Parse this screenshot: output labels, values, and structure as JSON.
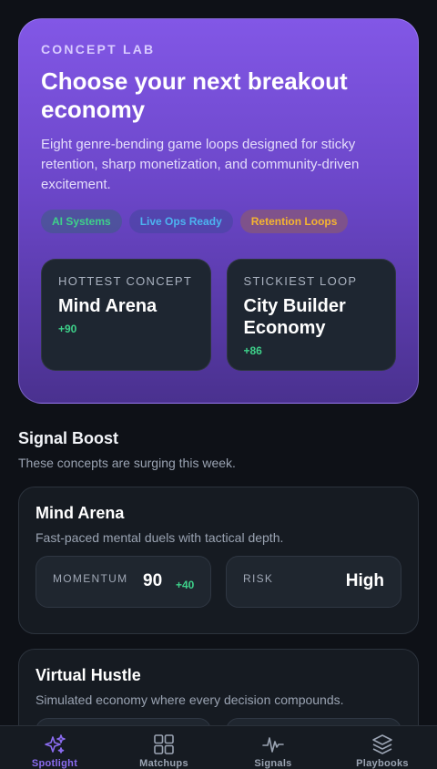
{
  "hero": {
    "eyebrow": "CONCEPT LAB",
    "title": "Choose your next breakout economy",
    "subtitle": "Eight genre-bending game loops designed for sticky retention, sharp monetization, and community-driven excitement.",
    "chips": [
      "AI Systems",
      "Live Ops Ready",
      "Retention Loops"
    ],
    "cards": [
      {
        "label": "HOTTEST CONCEPT",
        "name": "Mind Arena",
        "delta": "+90"
      },
      {
        "label": "STICKIEST LOOP",
        "name": "City Builder Economy",
        "delta": "+86"
      }
    ]
  },
  "section": {
    "title": "Signal Boost",
    "subtitle": "These concepts are surging this week."
  },
  "concepts": [
    {
      "name": "Mind Arena",
      "description": "Fast-paced mental duels with tactical depth.",
      "momentum_label": "MOMENTUM",
      "momentum_value": "90",
      "momentum_delta": "+40",
      "risk_label": "RISK",
      "risk_value": "High"
    },
    {
      "name": "Virtual Hustle",
      "description": "Simulated economy where every decision compounds."
    }
  ],
  "nav": {
    "items": [
      {
        "label": "Spotlight",
        "icon": "sparkles-icon",
        "active": true
      },
      {
        "label": "Matchups",
        "icon": "grid-icon"
      },
      {
        "label": "Signals",
        "icon": "pulse-icon"
      },
      {
        "label": "Playbooks",
        "icon": "layers-icon"
      }
    ]
  },
  "colors": {
    "accent": "#8b6cf0",
    "positive": "#3ed18a",
    "background": "#0e1117"
  }
}
